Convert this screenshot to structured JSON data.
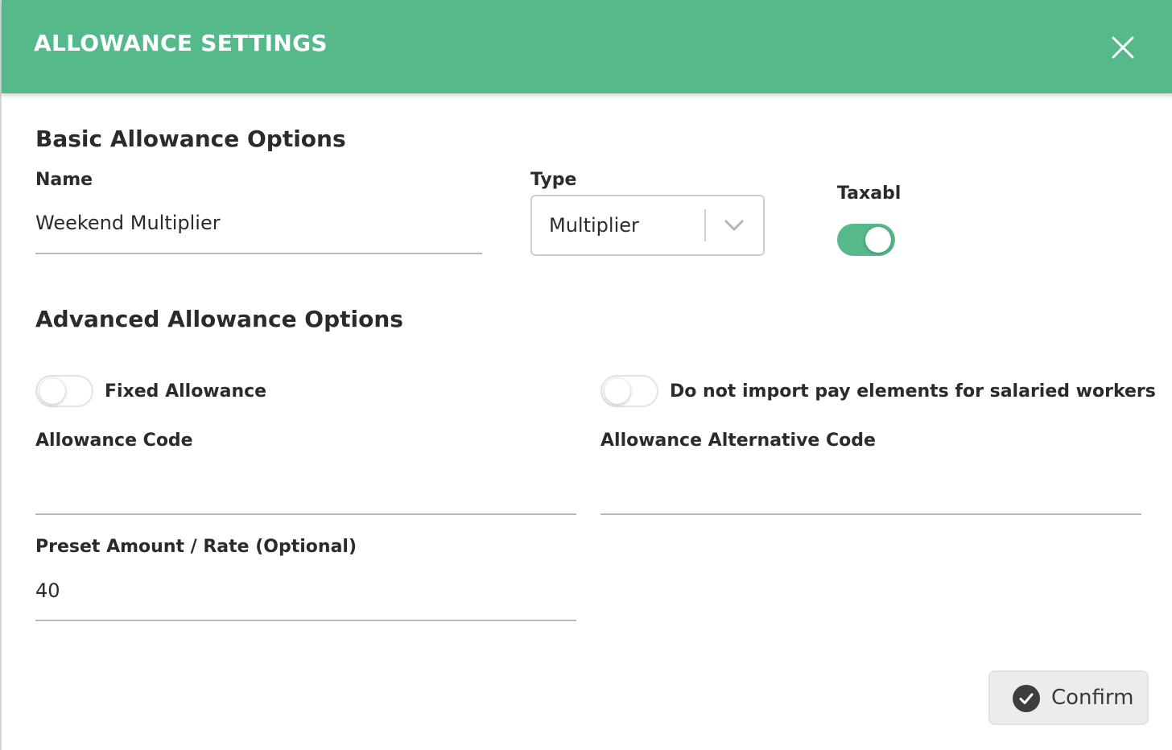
{
  "header": {
    "title": "ALLOWANCE SETTINGS",
    "close_icon": "close-icon"
  },
  "basic": {
    "section_title": "Basic Allowance Options",
    "name_label": "Name",
    "name_value": "Weekend Multiplier",
    "type_label": "Type",
    "type_value": "Multiplier",
    "taxable_label": "Taxable",
    "taxable_on": true
  },
  "advanced": {
    "section_title": "Advanced Allowance Options",
    "fixed_allowance_label": "Fixed Allowance",
    "fixed_allowance_on": false,
    "no_import_label": "Do not import pay elements for salaried workers",
    "no_import_on": false,
    "code_label": "Allowance Code",
    "code_value": "",
    "alt_code_label": "Allowance Alternative Code",
    "alt_code_value": "",
    "preset_label": "Preset Amount / Rate (Optional)",
    "preset_value": "40"
  },
  "footer": {
    "confirm_label": "Confirm"
  },
  "colors": {
    "header_bg": "#56b98a",
    "toggle_on": "#56b98a",
    "confirm_bg": "#ececec"
  }
}
